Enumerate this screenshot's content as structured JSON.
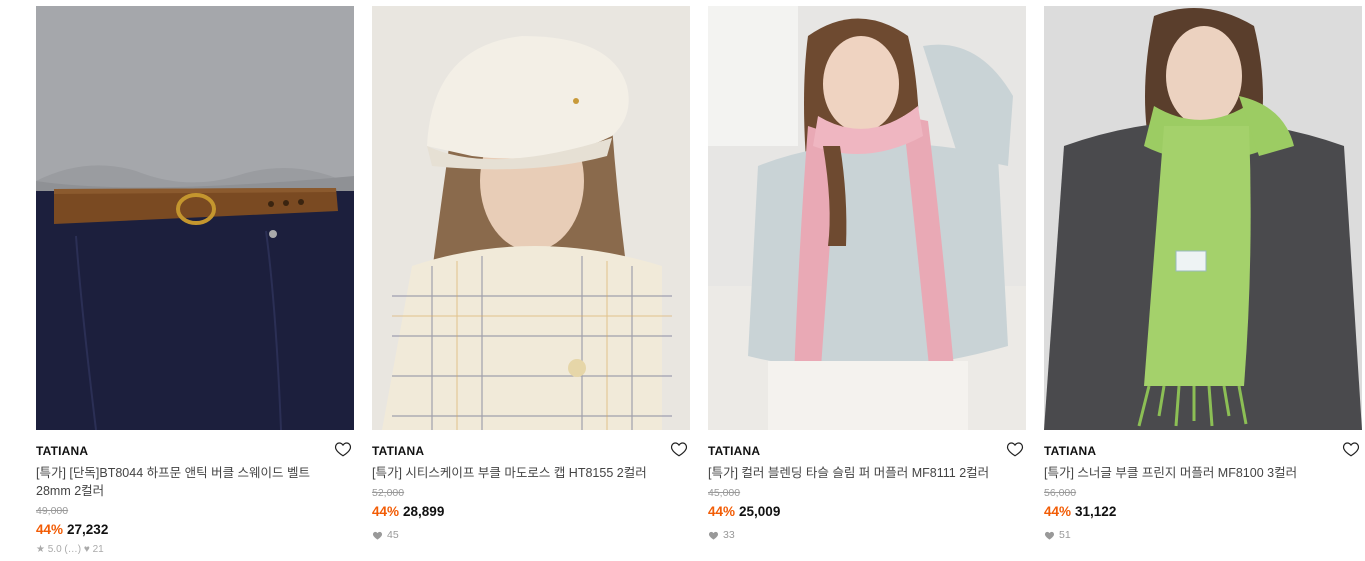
{
  "products": [
    {
      "brand": "TATIANA",
      "title": "[특가] [단독]BT8044 하프문 앤틱 버클 스웨이드 벨트 28mm 2컬러",
      "original_price": "49,000",
      "discount": "44%",
      "price": "27,232",
      "likes": "",
      "reviews": "★ 5.0 (…)  ♥ 21",
      "image_icon": "belt-photo"
    },
    {
      "brand": "TATIANA",
      "title": "[특가] 시티스케이프 부클 마도로스 캡 HT8155 2컬러",
      "original_price": "52,000",
      "discount": "44%",
      "price": "28,899",
      "likes": "45",
      "image_icon": "cap-photo"
    },
    {
      "brand": "TATIANA",
      "title": "[특가] 컬러 블렌딩 타슬 슬림 퍼 머플러 MF8111 2컬러",
      "original_price": "45,000",
      "discount": "44%",
      "price": "25,009",
      "likes": "33",
      "image_icon": "pink-scarf-photo"
    },
    {
      "brand": "TATIANA",
      "title": "[특가] 스너글 부클 프린지 머플러 MF8100 3컬러",
      "original_price": "56,000",
      "discount": "44%",
      "price": "31,122",
      "likes": "51",
      "image_icon": "green-scarf-photo"
    }
  ],
  "colors": {
    "discount": "#f25c05",
    "strike": "#9a9a9a",
    "like": "#999999"
  }
}
